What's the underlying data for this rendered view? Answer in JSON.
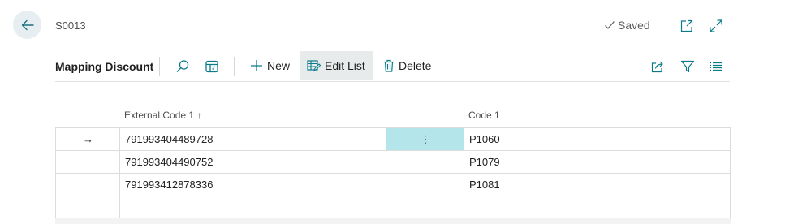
{
  "header": {
    "title": "S0013",
    "saved_label": "Saved"
  },
  "toolbar": {
    "title": "Mapping Discount",
    "new_label": "New",
    "edit_list_label": "Edit List",
    "delete_label": "Delete"
  },
  "table": {
    "columns": [
      "External Code 1 ↑",
      "Code 1"
    ],
    "selected_row_marker": "→",
    "row_menu_glyph": "⋮",
    "rows": [
      {
        "external_code": "791993404489728",
        "code": "P1060"
      },
      {
        "external_code": "791993404490752",
        "code": "P1079"
      },
      {
        "external_code": "791993412878336",
        "code": "P1081"
      },
      {
        "external_code": "",
        "code": ""
      }
    ]
  },
  "colors": {
    "accent": "#0b7b8a",
    "selected_cell": "#b3e5ea",
    "back_button_bg": "#e6eef1",
    "active_button_bg": "#e8ebec"
  },
  "icons": [
    "arrow-left-icon",
    "checkmark-icon",
    "open-new-window-icon",
    "expand-icon",
    "search-icon",
    "filter-pane-icon",
    "plus-icon",
    "edit-list-icon",
    "trash-icon",
    "share-icon",
    "filter-icon",
    "list-view-icon"
  ]
}
